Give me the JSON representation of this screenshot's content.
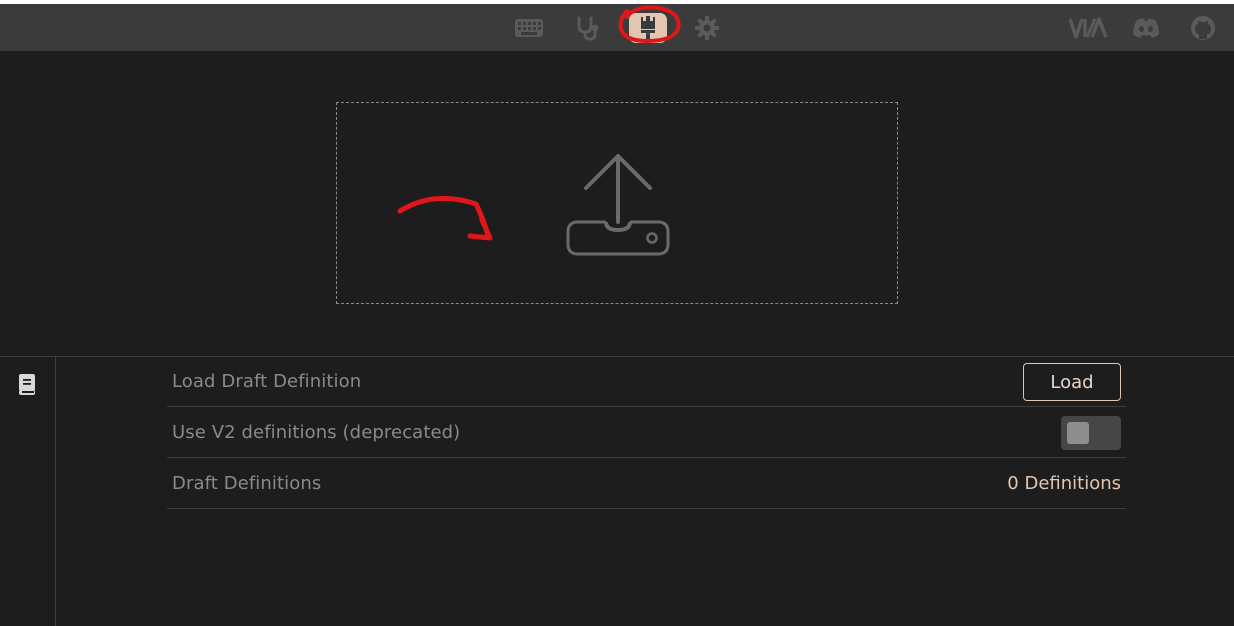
{
  "topbar": {
    "nav_icons": [
      {
        "name": "keyboard-icon"
      },
      {
        "name": "stethoscope-icon"
      },
      {
        "name": "paintbrush-icon",
        "active": true
      },
      {
        "name": "gear-icon"
      }
    ],
    "via_logo": "V/A",
    "external_icons": [
      "discord-icon",
      "github-icon"
    ]
  },
  "dropzone": {
    "icon": "upload-icon"
  },
  "sidebar": {
    "icon": "book-icon"
  },
  "settings": {
    "load_draft": {
      "label": "Load Draft Definition",
      "button_label": "Load"
    },
    "use_v2": {
      "label": "Use V2 definitions (deprecated)",
      "enabled": false
    },
    "draft_definitions": {
      "label": "Draft Definitions",
      "value": "0 Definitions"
    }
  },
  "colors": {
    "accent": "#e3c6b2",
    "background": "#1e1d1e",
    "topbar": "#3b3b3b",
    "annotation": "#e0161b"
  }
}
